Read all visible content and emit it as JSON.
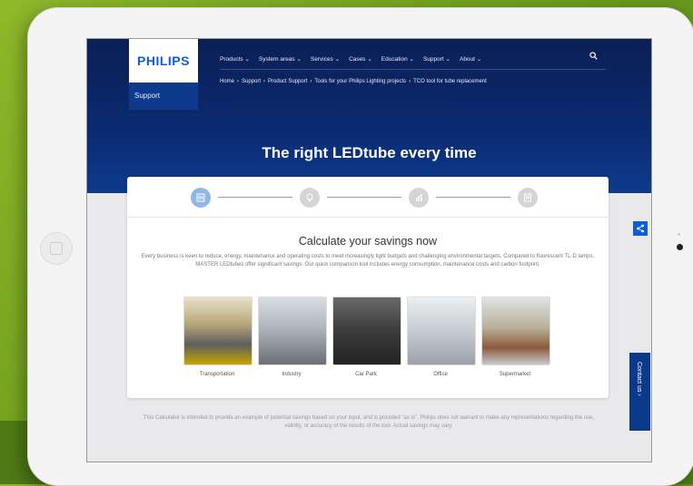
{
  "brand": {
    "logo": "PHILIPS",
    "section": "Support"
  },
  "nav": {
    "items": [
      "Products ⌄",
      "System areas ⌄",
      "Services ⌄",
      "Cases ⌄",
      "Education ⌄",
      "Support ⌄",
      "About ⌄"
    ]
  },
  "breadcrumb": [
    "Home",
    "›",
    "Support",
    "›",
    "Product Support",
    "›",
    "Tools for your Philips Lighting projects",
    "›",
    "TCO tool for tube replacement"
  ],
  "hero": {
    "title": "The right LEDtube every time"
  },
  "steps": {
    "count": 4,
    "active_index": 0,
    "icons": [
      "building-icon",
      "lightbulb-icon",
      "bar-chart-icon",
      "report-icon"
    ]
  },
  "calculator": {
    "title": "Calculate your savings now",
    "description": "Every business is keen to reduce, energy, maintenance and operating costs to meet increasingly tight budgets and challenging environmental targets. Compared to fluorescent TL-D lamps, MASTER LEDtubes offer significant savings. Our quick comparison tool includes energy consumption, maintenance costs and carbon footprint.",
    "options": [
      {
        "label": "Transportation"
      },
      {
        "label": "Industry"
      },
      {
        "label": "Car Park"
      },
      {
        "label": "Office"
      },
      {
        "label": "Supermarket"
      }
    ]
  },
  "disclaimer": "This Calculator is intended to provide an example of potential savings based on your input, and is provided \"as is\". Philips does not warrant or make any representations regarding the use, validity, or accuracy of the results of the tool. Actual savings may vary.",
  "contact_tab": {
    "label": "Contact us  ›"
  },
  "colors": {
    "brand_blue": "#0b5ed7",
    "hero_dark": "#0b1f54",
    "active_step": "#8fb7e6"
  }
}
